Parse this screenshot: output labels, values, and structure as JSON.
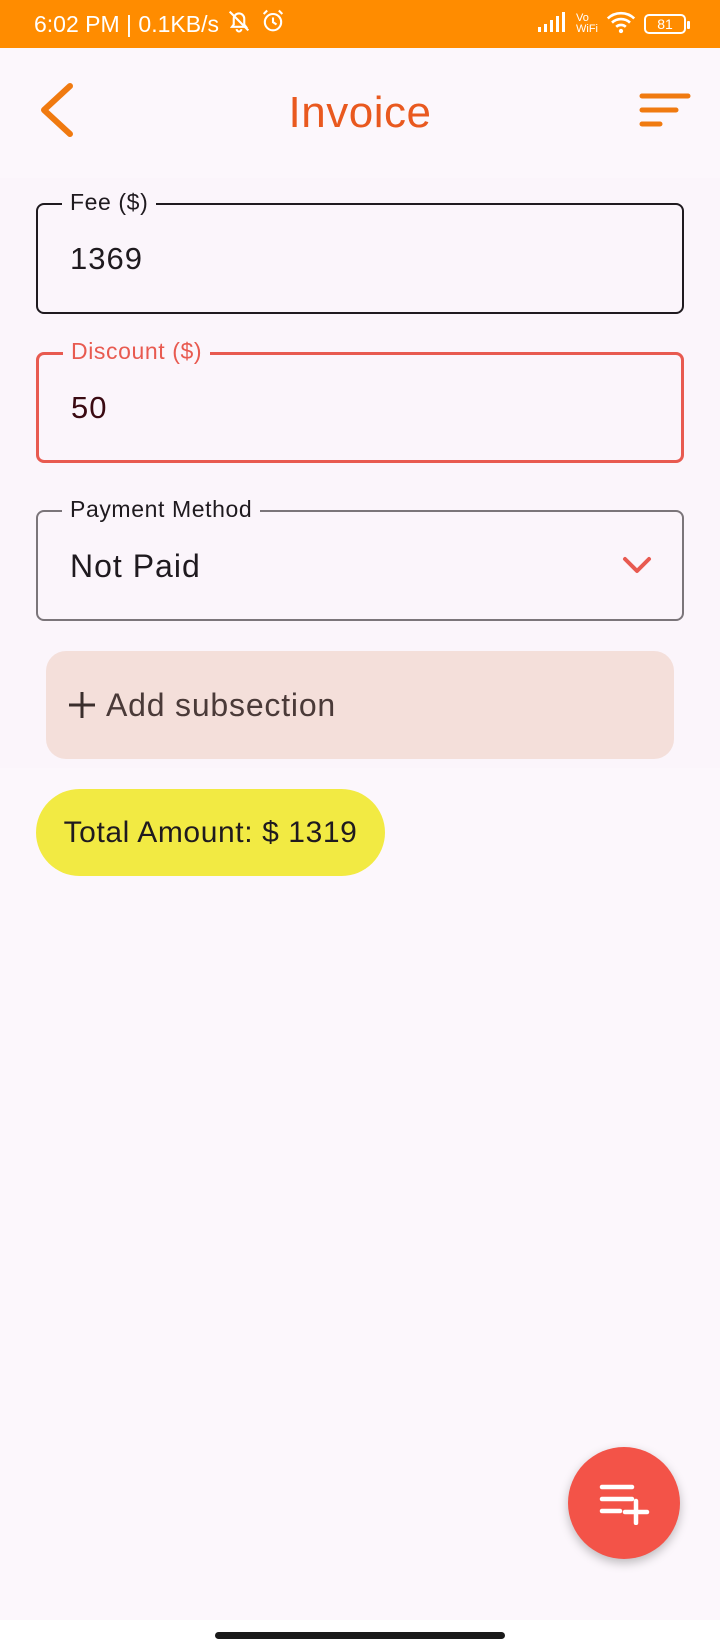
{
  "status_bar": {
    "time_and_speed": "6:02 PM | 0.1KB/s",
    "vowifi_top": "Vo",
    "vowifi_bottom": "WiFi",
    "battery": "81"
  },
  "header": {
    "title": "Invoice",
    "back_icon": "chevron-left-icon",
    "menu_icon": "sort-menu-icon"
  },
  "form": {
    "fee": {
      "label": "Fee ($)",
      "value": "1369"
    },
    "discount": {
      "label": "Discount ($)",
      "value": "50"
    },
    "payment_method": {
      "label": "Payment Method",
      "value": "Not Paid"
    },
    "add_subsection_label": "Add subsection",
    "total": "Total Amount: $ 1319"
  },
  "colors": {
    "status_bar": "#FF8C00",
    "title": "#E9591F",
    "error_accent": "#E85A50",
    "total_chip": "#F2EA43",
    "fab": "#F35348",
    "subsection_bg": "#F4DFDA"
  },
  "fab": {
    "icon": "playlist-add-icon"
  }
}
